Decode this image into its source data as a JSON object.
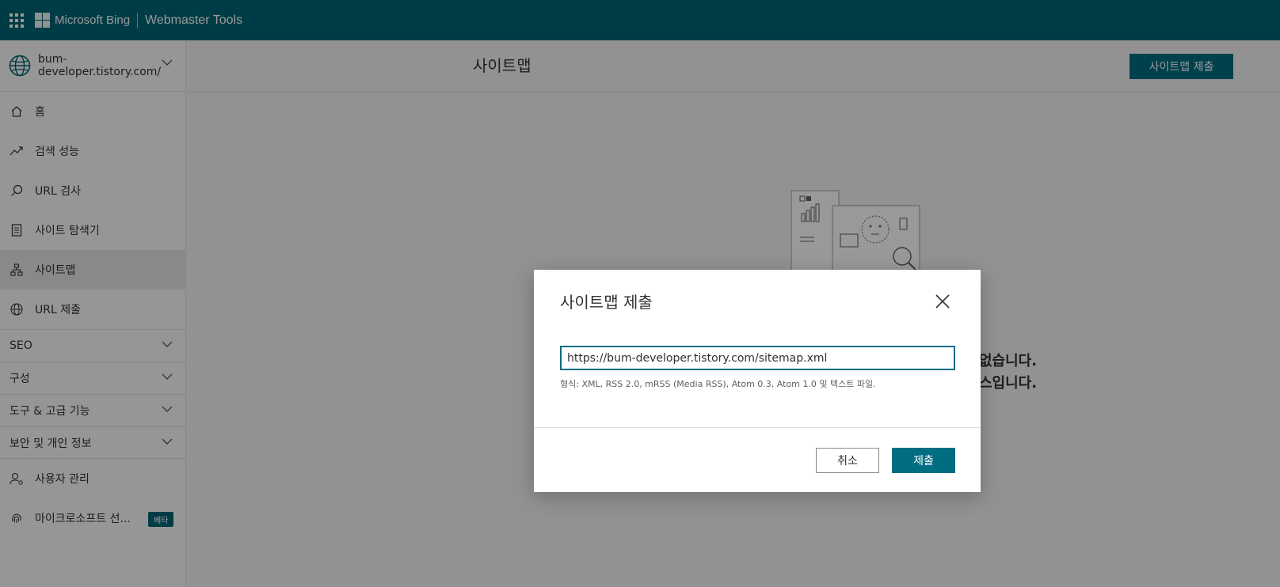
{
  "topbar": {
    "brand": "Microsoft Bing",
    "product": "Webmaster Tools"
  },
  "sidebar": {
    "site": "bum-developer.tistory.com/",
    "items": [
      {
        "label": "홈",
        "icon": "home-icon"
      },
      {
        "label": "검색 성능",
        "icon": "trend-icon"
      },
      {
        "label": "URL 검사",
        "icon": "search-icon"
      },
      {
        "label": "사이트 탐색기",
        "icon": "document-icon"
      },
      {
        "label": "사이트맵",
        "icon": "sitemap-icon",
        "active": true
      },
      {
        "label": "URL 제출",
        "icon": "globe-icon"
      }
    ],
    "groups": [
      {
        "label": "SEO"
      },
      {
        "label": "구성"
      },
      {
        "label": "도구 & 고급 기능"
      },
      {
        "label": "보안 및 개인 정보"
      }
    ],
    "footer_items": [
      {
        "label": "사용자 관리",
        "icon": "user-settings-icon"
      },
      {
        "label": "마이크로소프트 선...",
        "icon": "fingerprint-icon",
        "badge": "베타"
      }
    ]
  },
  "main": {
    "title": "사이트맵",
    "submit_button": "사이트맵 제출",
    "empty_line1": "없습니다.",
    "empty_line2": "스입니다."
  },
  "dialog": {
    "title": "사이트맵 제출",
    "input_value": "https://bum-developer.tistory.com/sitemap.xml",
    "hint": "형식: XML, RSS 2.0, mRSS (Media RSS), Atom 0.3, Atom 1.0 및 텍스트 파일.",
    "cancel": "취소",
    "submit": "제출"
  },
  "colors": {
    "brand": "#006473",
    "accent": "#006d80"
  }
}
